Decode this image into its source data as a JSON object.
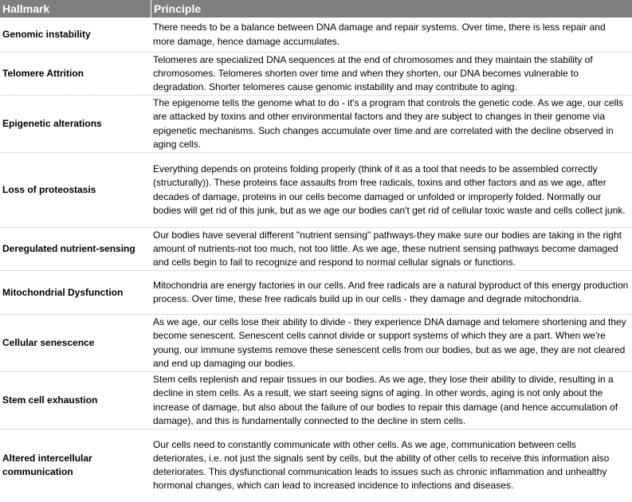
{
  "header": {
    "hallmark": "Hallmark",
    "principle": "Principle"
  },
  "rows": [
    {
      "hallmark": "Genomic instability",
      "principle": "There needs to be a balance between DNA damage and repair systems. Over time, there is less repair and more damage, hence damage accumulates."
    },
    {
      "hallmark": "Telomere Attrition",
      "principle": "Telomeres are specialized DNA sequences at the end of chromosomes and they maintain the stability of chromosomes. Telomeres shorten over time and when they shorten, our DNA becomes vulnerable to degradation. Shorter telomeres cause genomic instability and may contribute to aging."
    },
    {
      "hallmark": "Epigenetic alterations",
      "principle": "The epigenome tells the genome what to do - it's a program that controls the genetic code. As we age, our cells are attacked by toxins and other environmental factors and  they are subject to changes in their genome via epigenetic mechanisms. Such changes accumulate over time and are correlated with the decline observed in aging cells."
    },
    {
      "hallmark": "Loss of proteostasis",
      "principle": "Everything depends on proteins folding properly (think of it as a tool that needs to be assembled correctly (structurally)). These proteins face assaults from free radicals, toxins and other factors and as we age, after decades of damage, proteins in our cells become damaged or unfolded or improperly folded. Normally our bodies will get rid of this junk, but as we age our bodies can't get rid of cellular toxic waste and cells collect junk."
    },
    {
      "hallmark": "Deregulated nutrient-sensing",
      "principle": "Our bodies have several different \"nutrient sensing\" pathways-they make sure our bodies are taking in the right amount of nutrients-not too much, not too little. As we age, these nutrient sensing pathways become damaged and cells begin to fail to recognize and respond to normal cellular signals or functions."
    },
    {
      "hallmark": "Mitochondrial Dysfunction",
      "principle": "Mitochondria are energy factories in our cells. And free radicals are a natural byproduct of this energy production process. Over time, these free radicals build up in our cells - they damage and degrade mitochondria."
    },
    {
      "hallmark": "Cellular senescence",
      "principle": "As we age, our cells lose their ability to divide - they experience DNA damage and telomere shortening and they become senescent. Senescent cells cannot divide or support systems of which they are a part. When we're young, our immune systems remove these senescent cells from our bodies, but as we age, they are not cleared and end up damaging our bodies."
    },
    {
      "hallmark": "Stem cell exhaustion",
      "principle": "Stem cells replenish and repair tissues in our bodies. As we age, they lose their ability to divide, resulting in a decline in stem cells. As a result, we start seeing signs of aging. In other words, aging is not only about the increase of damage, but also about the failure of our bodies to repair this damage (and hence accumulation of damage), and this is fundamentally connected to the decline in stem cells."
    },
    {
      "hallmark": "Altered intercellular communication",
      "principle": "Our cells need to constantly communicate with other cells. As we age, communication between cells deteriorates, i.e. not just the signals sent by cells, but the ability of other cells to receive this information also deteriorates. This dysfunctional communication leads to issues such as chronic inflammation and unhealthy hormonal changes, which can lead to increased incidence to infections and diseases."
    }
  ]
}
